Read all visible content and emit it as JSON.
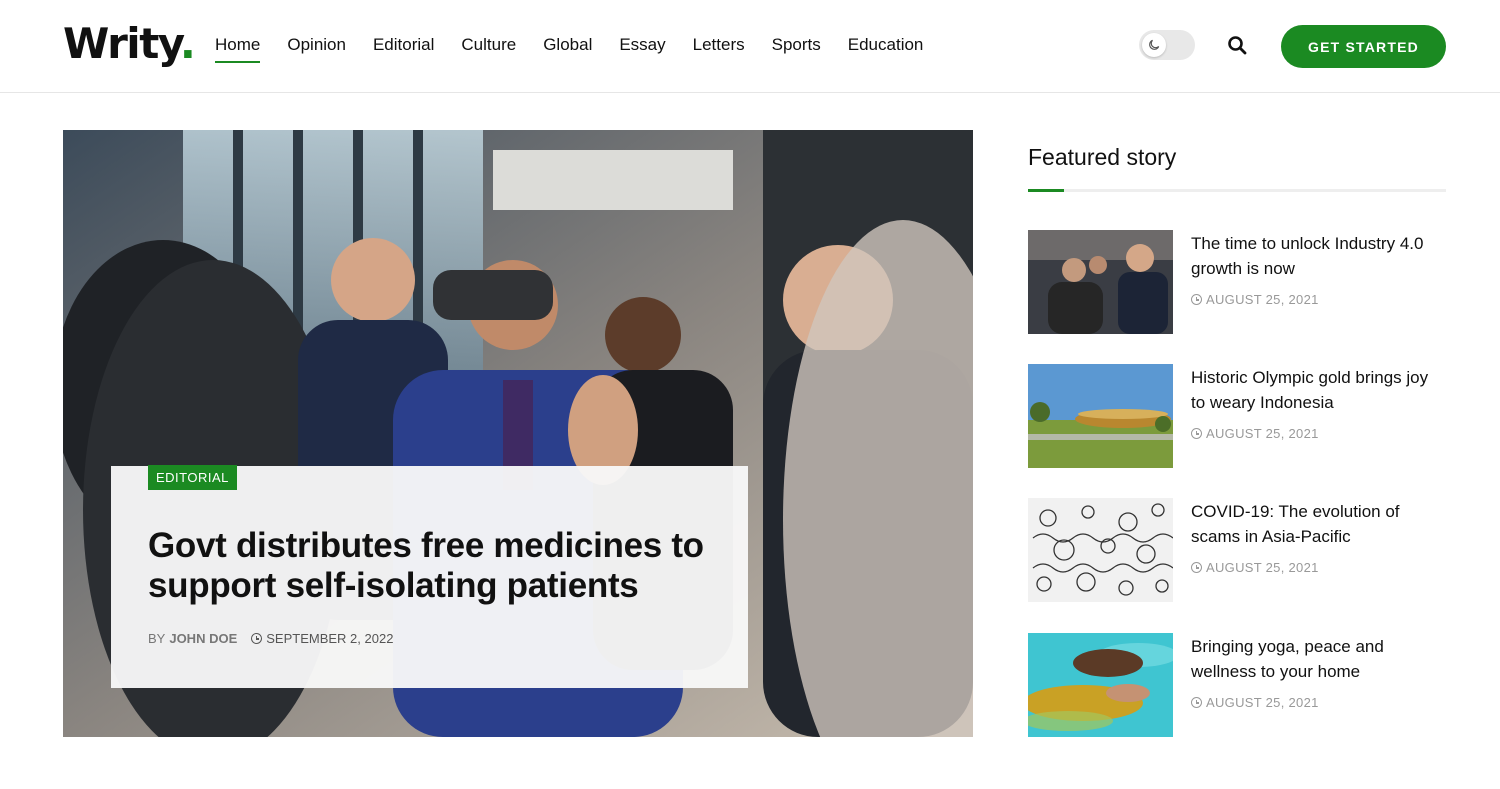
{
  "header": {
    "logo_text": "Writy",
    "logo_dot": ".",
    "nav": [
      "Home",
      "Opinion",
      "Editorial",
      "Culture",
      "Global",
      "Essay",
      "Letters",
      "Sports",
      "Education"
    ],
    "active_nav": "Home",
    "cta_label": "GET STARTED"
  },
  "hero": {
    "category": "EDITORIAL",
    "title": "Govt distributes free medicines to support self-isolating patients",
    "by_prefix": "BY",
    "author": "JOHN DOE",
    "date": "SEPTEMBER 2, 2022"
  },
  "sidebar": {
    "heading": "Featured story",
    "stories": [
      {
        "title": "The time to unlock Industry 4.0 growth is now",
        "date": "AUGUST 25, 2021"
      },
      {
        "title": "Historic Olympic gold brings joy to weary Indonesia",
        "date": "AUGUST 25, 2021"
      },
      {
        "title": "COVID-19: The evolution of scams in Asia-Pacific",
        "date": "AUGUST 25, 2021"
      },
      {
        "title": "Bringing yoga, peace and wellness to your home",
        "date": "AUGUST 25, 2021"
      }
    ]
  },
  "colors": {
    "accent": "#1b8a22",
    "text": "#111111",
    "muted": "#999999"
  },
  "icons": {
    "toggle": "moon-icon",
    "search": "search-icon",
    "date": "clock-icon"
  }
}
